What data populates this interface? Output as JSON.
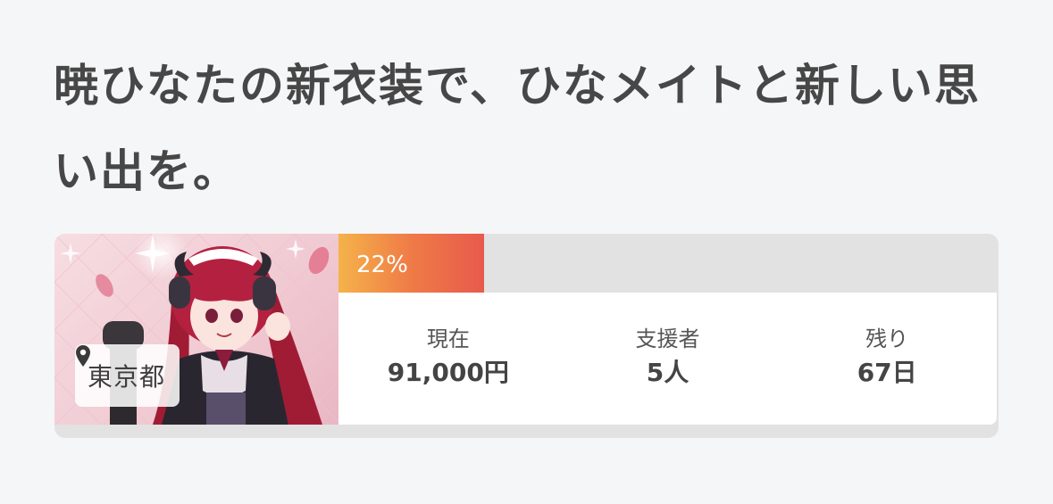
{
  "project": {
    "title": "暁ひなたの新衣装で、ひなメイトと新しい思い出を。",
    "location": "東京都",
    "progress_label": "22%",
    "progress_fraction": 0.22,
    "stats": [
      {
        "label": "現在",
        "value": "91,000円"
      },
      {
        "label": "支援者",
        "value": "5人"
      },
      {
        "label": "残り",
        "value": "67日"
      }
    ]
  },
  "colors": {
    "background": "#f5f6f8",
    "progress_start": "#f5b24a",
    "progress_end": "#e85a4c",
    "track": "#e2e2e2"
  },
  "icons": {
    "location": "map-pin-icon"
  }
}
